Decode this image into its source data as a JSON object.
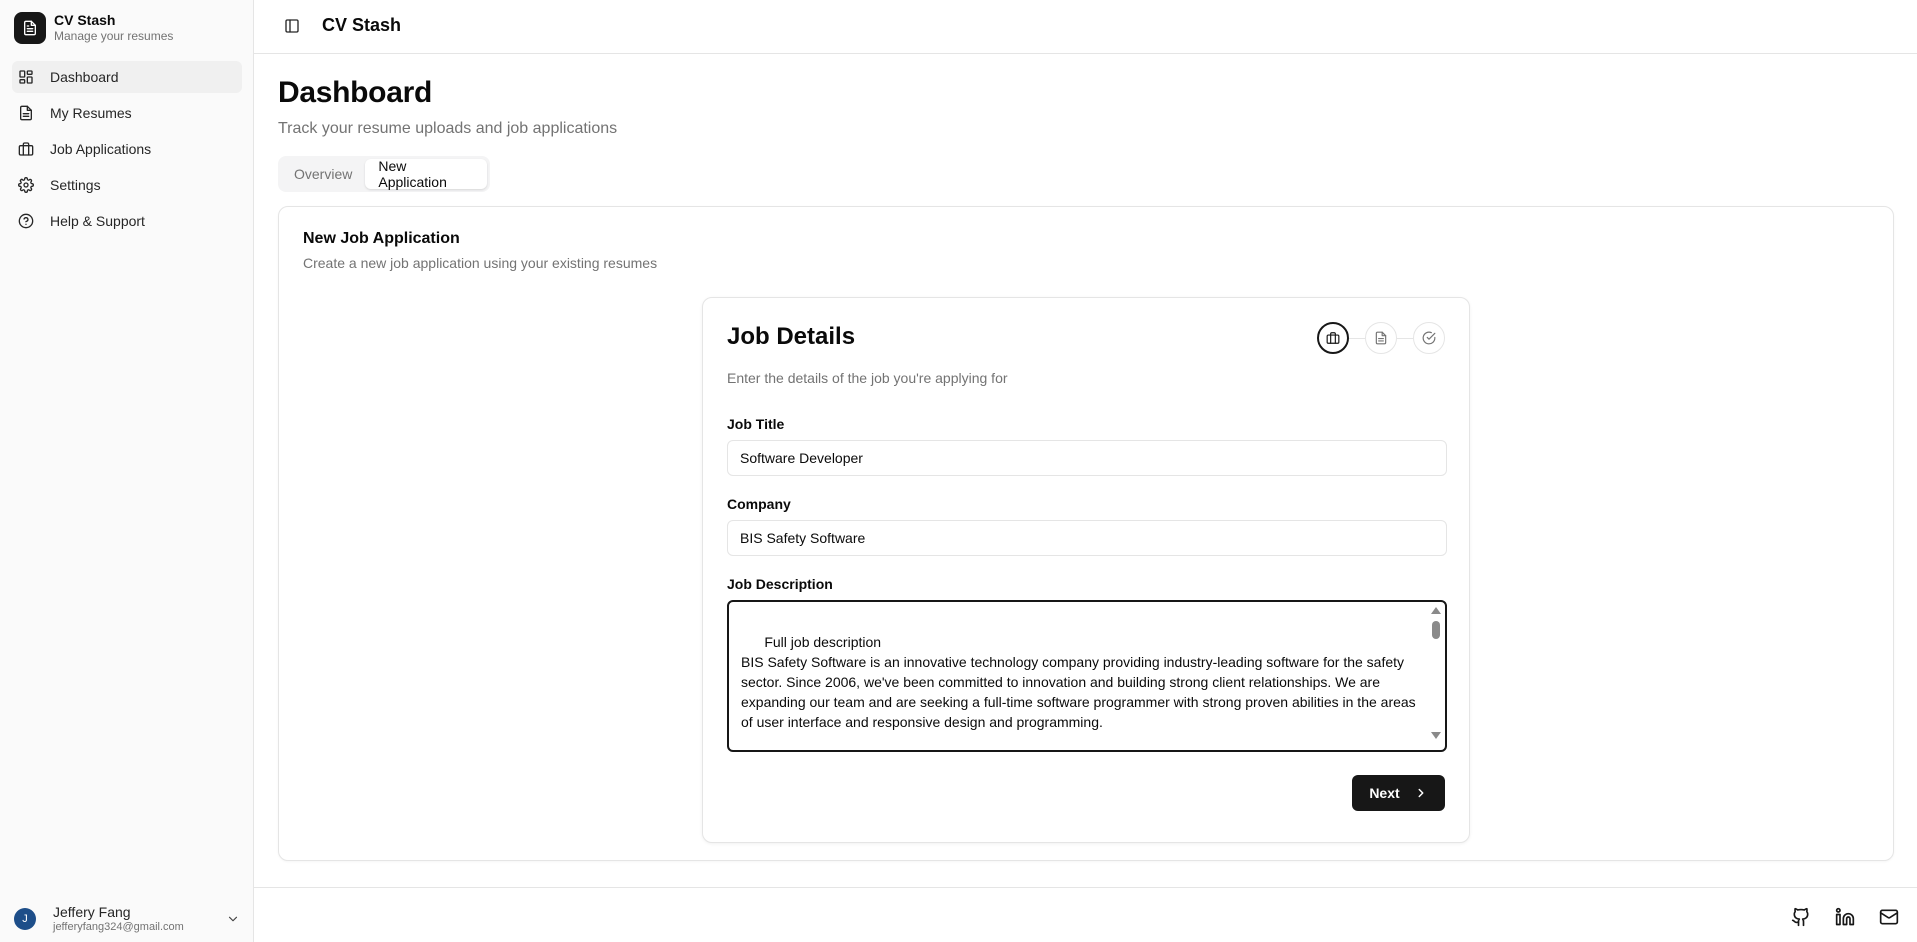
{
  "app": {
    "name": "CV Stash",
    "tagline": "Manage your resumes",
    "top_title": "CV Stash"
  },
  "sidebar": {
    "items": [
      {
        "label": "Dashboard",
        "icon": "dashboard-icon",
        "active": true
      },
      {
        "label": "My Resumes",
        "icon": "file-text-icon"
      },
      {
        "label": "Job Applications",
        "icon": "briefcase-icon"
      },
      {
        "label": "Settings",
        "icon": "gear-icon"
      },
      {
        "label": "Help & Support",
        "icon": "help-circle-icon"
      }
    ]
  },
  "user": {
    "initial": "J",
    "name": "Jeffery Fang",
    "email": "jefferyfang324@gmail.com"
  },
  "page": {
    "title": "Dashboard",
    "subtitle": "Track your resume uploads and job applications"
  },
  "tabs": [
    {
      "label": "Overview"
    },
    {
      "label": "New Application",
      "active": true
    }
  ],
  "card": {
    "title": "New Job Application",
    "description": "Create a new job application using your existing resumes"
  },
  "form": {
    "title": "Job Details",
    "description": "Enter the details of the job you're applying for",
    "steps": [
      "briefcase-icon",
      "file-text-icon",
      "check-circle-icon"
    ],
    "job_title_label": "Job Title",
    "job_title_value": "Software Developer",
    "company_label": "Company",
    "company_value": "BIS Safety Software",
    "description_label": "Job Description",
    "description_value": "Full job description\nBIS Safety Software is an innovative technology company providing industry-leading software for the safety sector. Since 2006, we've been committed to innovation and building strong client relationships. We are expanding our team and are seeking a full-time software programmer with strong proven abilities in the areas of user interface and responsive design and programming.\n\nYour next opportunity is just a play button away! Join Our Development Team at BIS Safety Software!",
    "next_label": "Next"
  },
  "footer": {
    "icons": [
      "github-icon",
      "linkedin-icon",
      "mail-icon"
    ]
  },
  "colors": {
    "primary": "#171717",
    "muted_text": "#737373",
    "border": "#e5e5e5",
    "sidebar_bg": "#fafafa",
    "avatar_bg": "#1d4e89"
  }
}
